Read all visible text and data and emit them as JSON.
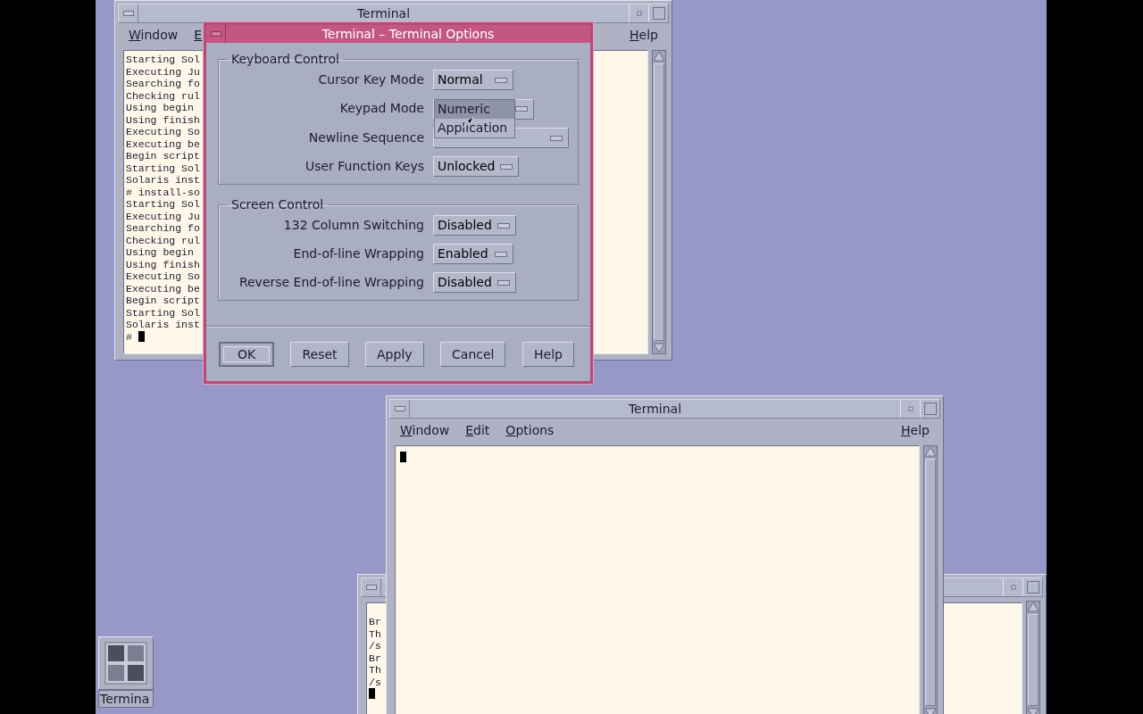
{
  "terminal_back": {
    "title": "Terminal",
    "menu": [
      {
        "label": "Window"
      },
      {
        "label": "E"
      },
      {
        "label": "Help"
      }
    ],
    "lines": [
      "Starting Sol",
      "Executing Ju",
      "Searching fo",
      "Checking rul",
      "Using begin",
      "Using finish",
      "Executing So",
      "Executing be",
      "Begin script",
      "Starting Sol",
      "Solaris inst",
      "# install-so",
      "Starting Sol",
      "Executing Ju",
      "Searching fo",
      "Checking rul",
      "Using begin",
      "Using finish",
      "Executing So",
      "Executing be",
      "Begin script",
      "Starting Sol",
      "Solaris inst",
      "#"
    ]
  },
  "terminal_bottom": {
    "lines": [
      "Br",
      "Th",
      "/s",
      "Br",
      "Th",
      "/s"
    ]
  },
  "terminal_front": {
    "title": "Terminal",
    "menu": [
      {
        "label": "Window"
      },
      {
        "label": "Edit"
      },
      {
        "label": "Options"
      },
      {
        "label": "Help"
      }
    ]
  },
  "options_dialog": {
    "title": "Terminal – Terminal Options",
    "groups": [
      {
        "title": "Keyboard Control",
        "rows": [
          {
            "label": "Cursor Key Mode",
            "value": "Normal"
          },
          {
            "label": "Keypad Mode",
            "expanded": true,
            "menu": [
              {
                "label": "Numeric",
                "selected": true
              },
              {
                "label": "Application",
                "selected": false
              }
            ]
          },
          {
            "label": "Newline Sequence"
          },
          {
            "label": "User Function Keys",
            "value": "Unlocked"
          }
        ]
      },
      {
        "title": "Screen Control",
        "rows": [
          {
            "label": "132 Column Switching",
            "value": "Disabled"
          },
          {
            "label": "End-of-line Wrapping",
            "value": "Enabled"
          },
          {
            "label": "Reverse End-of-line Wrapping",
            "value": "Disabled"
          }
        ]
      }
    ],
    "buttons": [
      {
        "label": "OK",
        "default": true
      },
      {
        "label": "Reset",
        "default": false
      },
      {
        "label": "Apply",
        "default": false
      },
      {
        "label": "Cancel",
        "default": false
      },
      {
        "label": "Help",
        "default": false
      }
    ]
  },
  "desktop_icon": {
    "label": "Termina"
  }
}
